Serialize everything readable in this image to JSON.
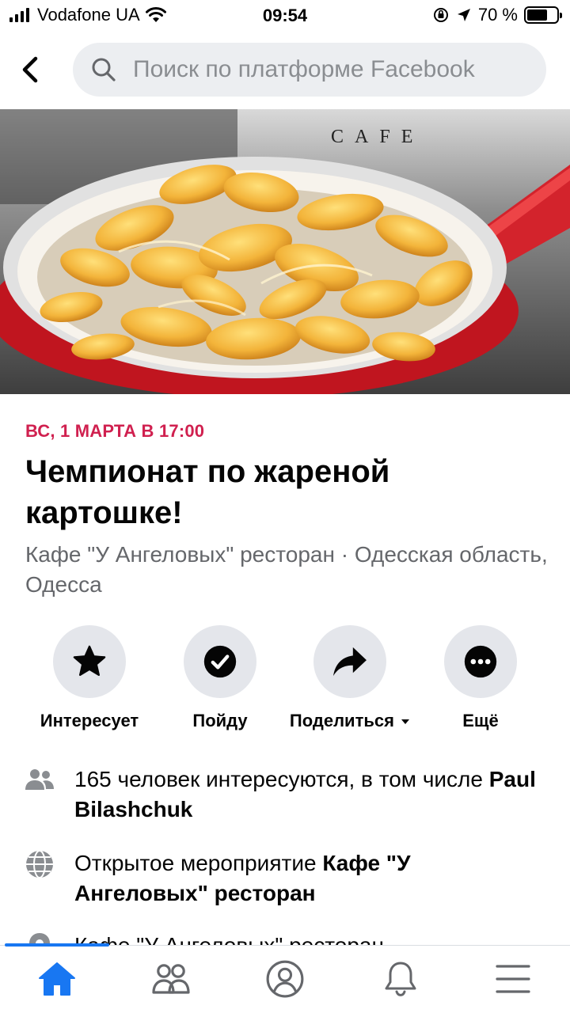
{
  "status_bar": {
    "carrier": "Vodafone UA",
    "time": "09:54",
    "battery_percent": "70 %",
    "battery_level": 0.7
  },
  "header": {
    "search_placeholder": "Поиск по платформе Facebook"
  },
  "cover": {
    "sign_text": "CAFE"
  },
  "event": {
    "date": "ВС, 1 МАРТА В 17:00",
    "title": "Чемпионат по жареной картошке!",
    "subtitle": "Кафе \"У Ангеловых\" ресторан · Одесская область, Одесса"
  },
  "actions": [
    {
      "label": "Интересует",
      "icon": "star-icon"
    },
    {
      "label": "Пойду",
      "icon": "check-circle-icon"
    },
    {
      "label": "Поделиться",
      "icon": "share-arrow-icon"
    },
    {
      "label": "Ещё",
      "icon": "more-icon"
    }
  ],
  "info": {
    "interested_text": "165 человек интересуются, в том числе ",
    "interested_name": "Paul Bilashchuk",
    "public_text": "Открытое мероприятие ",
    "public_host": "Кафе \"У Ангеловых\" ресторан",
    "location_text": "Кафе \"У Ангеловых\" ресторан"
  },
  "nav": {
    "items": [
      "home-icon",
      "friends-icon",
      "profile-icon",
      "notifications-icon",
      "menu-icon"
    ],
    "active": "home-icon"
  },
  "colors": {
    "accent": "#1877f2",
    "date": "#d0204f",
    "pan": "#d3232c",
    "potato": "#f2b63a"
  }
}
